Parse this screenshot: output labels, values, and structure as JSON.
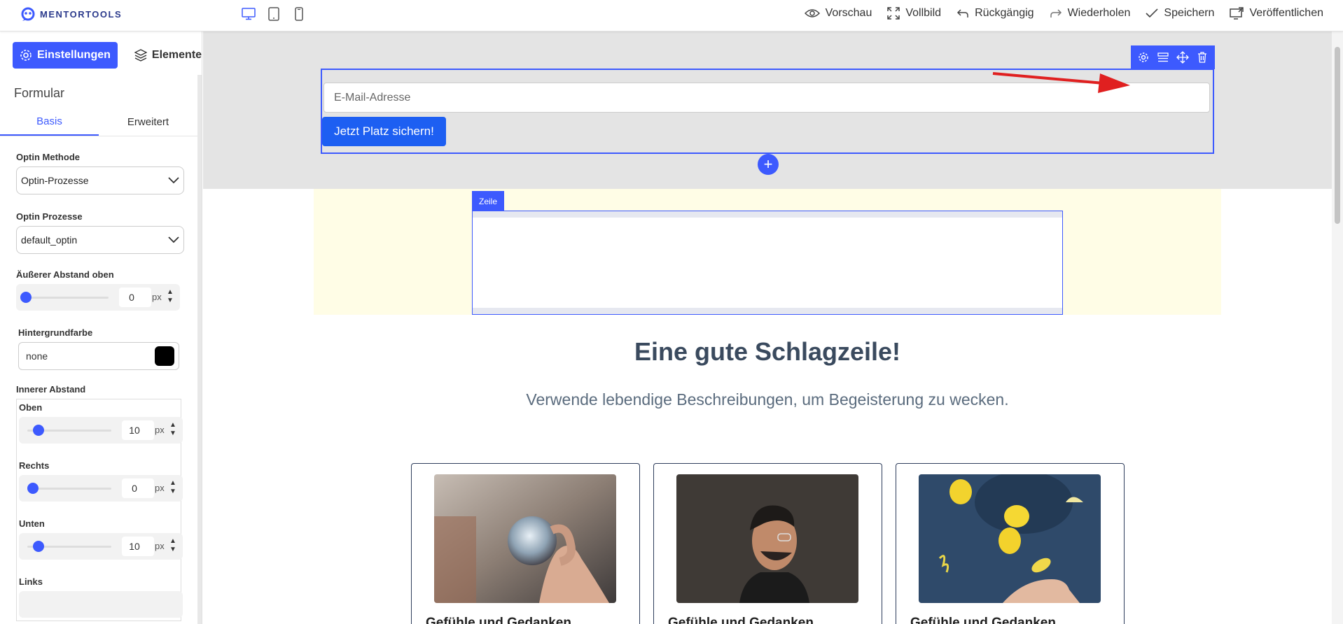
{
  "brand": {
    "name": "MENTORTOOLS"
  },
  "devices": [
    {
      "icon": "desktop-icon"
    },
    {
      "icon": "tablet-icon"
    },
    {
      "icon": "mobile-icon"
    }
  ],
  "actions": {
    "preview": "Vorschau",
    "fullscreen": "Vollbild",
    "undo": "Rückgängig",
    "redo": "Wiederholen",
    "save": "Speichern",
    "publish": "Veröffentlichen"
  },
  "sidebar": {
    "tabs": {
      "settings": "Einstellungen",
      "elements": "Elemente"
    },
    "title": "Formular",
    "subtabs": {
      "basic": "Basis",
      "advanced": "Erweitert"
    },
    "optin_method": {
      "label": "Optin Methode",
      "value": "Optin-Prozesse"
    },
    "optin_process": {
      "label": "Optin Prozesse",
      "value": "default_optin"
    },
    "margin_top": {
      "label": "Äußerer Abstand oben",
      "value": "0",
      "unit": "px"
    },
    "bg_color": {
      "label": "Hintergrundfarbe",
      "value": "none",
      "swatch": "#000000"
    },
    "inner_padding": {
      "label": "Innerer Abstand",
      "top": {
        "label": "Oben",
        "value": "10",
        "unit": "px"
      },
      "right": {
        "label": "Rechts",
        "value": "0",
        "unit": "px"
      },
      "bottom": {
        "label": "Unten",
        "value": "10",
        "unit": "px"
      },
      "left": {
        "label": "Links"
      }
    }
  },
  "canvas": {
    "email_placeholder": "E-Mail-Adresse",
    "cta_label": "Jetzt Platz sichern!",
    "add_symbol": "+",
    "row_tag": "Zeile",
    "headline": "Eine gute Schlagzeile!",
    "subline": "Verwende lebendige Beschreibungen, um Begeisterung zu wecken.",
    "cards": [
      {
        "title": "Gefühle und Gedanken"
      },
      {
        "title": "Gefühle und Gedanken"
      },
      {
        "title": "Gefühle und Gedanken"
      }
    ]
  },
  "colors": {
    "accent": "#3d5afe",
    "cta": "#1d5ff2",
    "arrow": "#e02020"
  }
}
